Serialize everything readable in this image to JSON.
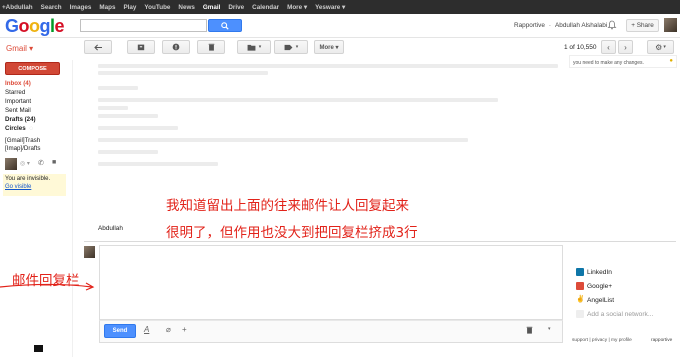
{
  "topbar": {
    "links": [
      "+Abdullah",
      "Search",
      "Images",
      "Maps",
      "Play",
      "YouTube",
      "News",
      "Gmail",
      "Drive",
      "Calendar",
      "More ▾",
      "Yesware ▾"
    ]
  },
  "header": {
    "logo": "Google",
    "rapportive_label": "Rapportive",
    "user_name": "Abdullah Alshalabi",
    "share_label": "+ Share"
  },
  "toolbar": {
    "gmail_label": "Gmail ▾",
    "more_label": "More ▾",
    "pager": "1 of 10,550"
  },
  "nav": {
    "compose": "COMPOSE",
    "items": [
      {
        "label": "Inbox (4)"
      },
      {
        "label": "Starred"
      },
      {
        "label": "Important"
      },
      {
        "label": "Sent Mail"
      },
      {
        "label": "Drafts (24)"
      },
      {
        "label": "Circles"
      },
      {
        "label": "[Gmail]Trash"
      },
      {
        "label": "[Imap]/Drafts"
      }
    ],
    "invisible_text": "You are invisible.",
    "go_visible": "Go visible"
  },
  "email": {
    "sender": "Abdullah"
  },
  "annotations": {
    "line1": "我知道留出上面的往来邮件让人回复起来",
    "line2": "很明了，但作用也没大到把回复栏挤成3行",
    "arrow_label": "邮件回复栏"
  },
  "reply": {
    "send_label": "Send"
  },
  "rapportive": {
    "notice": "you need to make any changes.",
    "social": [
      {
        "name": "LinkedIn",
        "color": "#0e76a8"
      },
      {
        "name": "Google+",
        "color": "#dd4b39"
      },
      {
        "name": "AngelList",
        "color": "#333333"
      }
    ],
    "add_social": "Add a social network...",
    "footer": "support | privacy | my profile",
    "brand": "rapportive"
  }
}
